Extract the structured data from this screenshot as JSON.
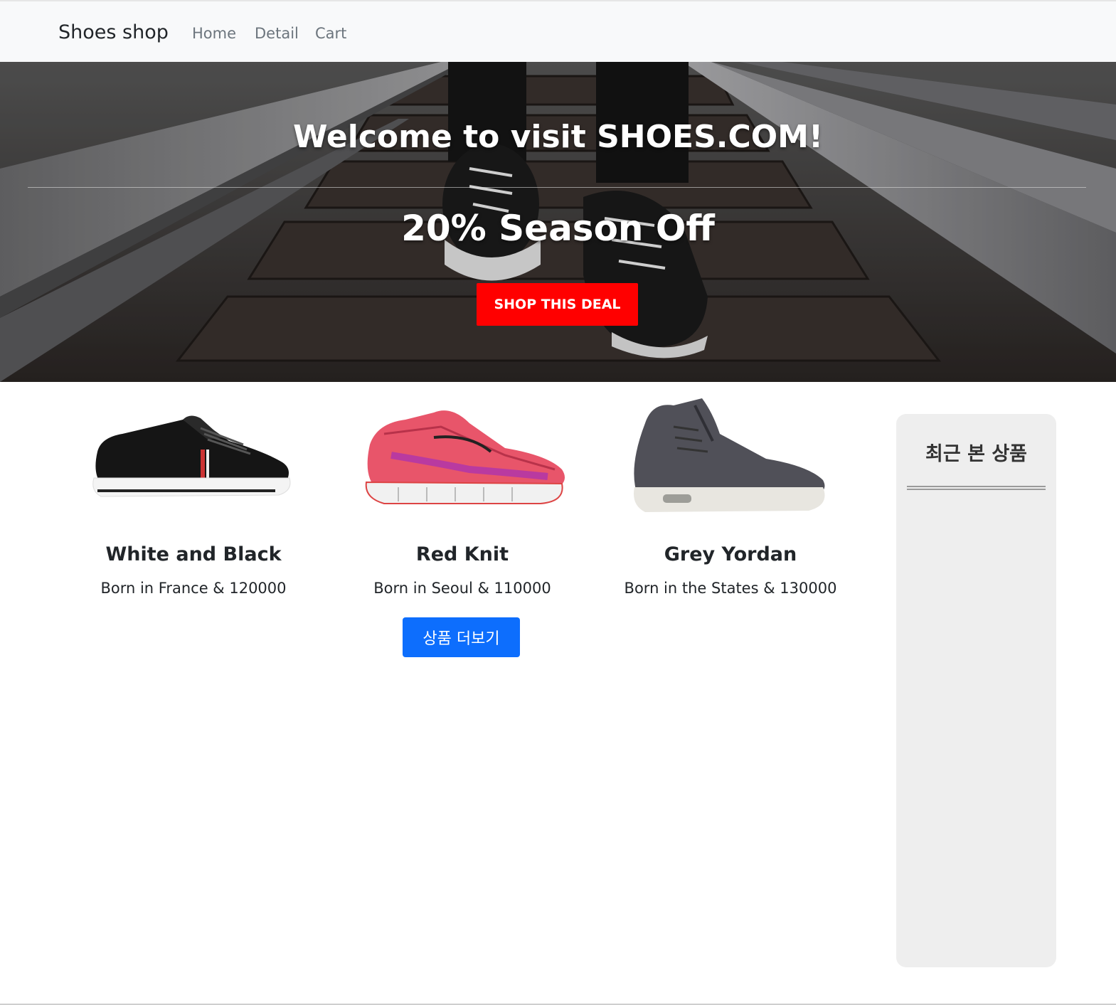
{
  "navbar": {
    "brand": "Shoes shop",
    "links": [
      "Home",
      "Detail",
      "Cart"
    ]
  },
  "hero": {
    "title": "Welcome to visit SHOES.COM!",
    "subtitle": "20% Season Off",
    "cta_label": "SHOP THIS DEAL",
    "cta_color": "#ff0000"
  },
  "products": [
    {
      "name": "White and Black",
      "desc": "Born in France & 120000",
      "image": "black-sneaker-image"
    },
    {
      "name": "Red Knit",
      "desc": "Born in Seoul & 110000",
      "image": "red-running-shoe-image"
    },
    {
      "name": "Grey Yordan",
      "desc": "Born in the States & 130000",
      "image": "grey-high-top-image"
    }
  ],
  "more_button": {
    "label": "상품 더보기",
    "color": "#0d6efd"
  },
  "recent": {
    "title": "최근 본 상품"
  }
}
